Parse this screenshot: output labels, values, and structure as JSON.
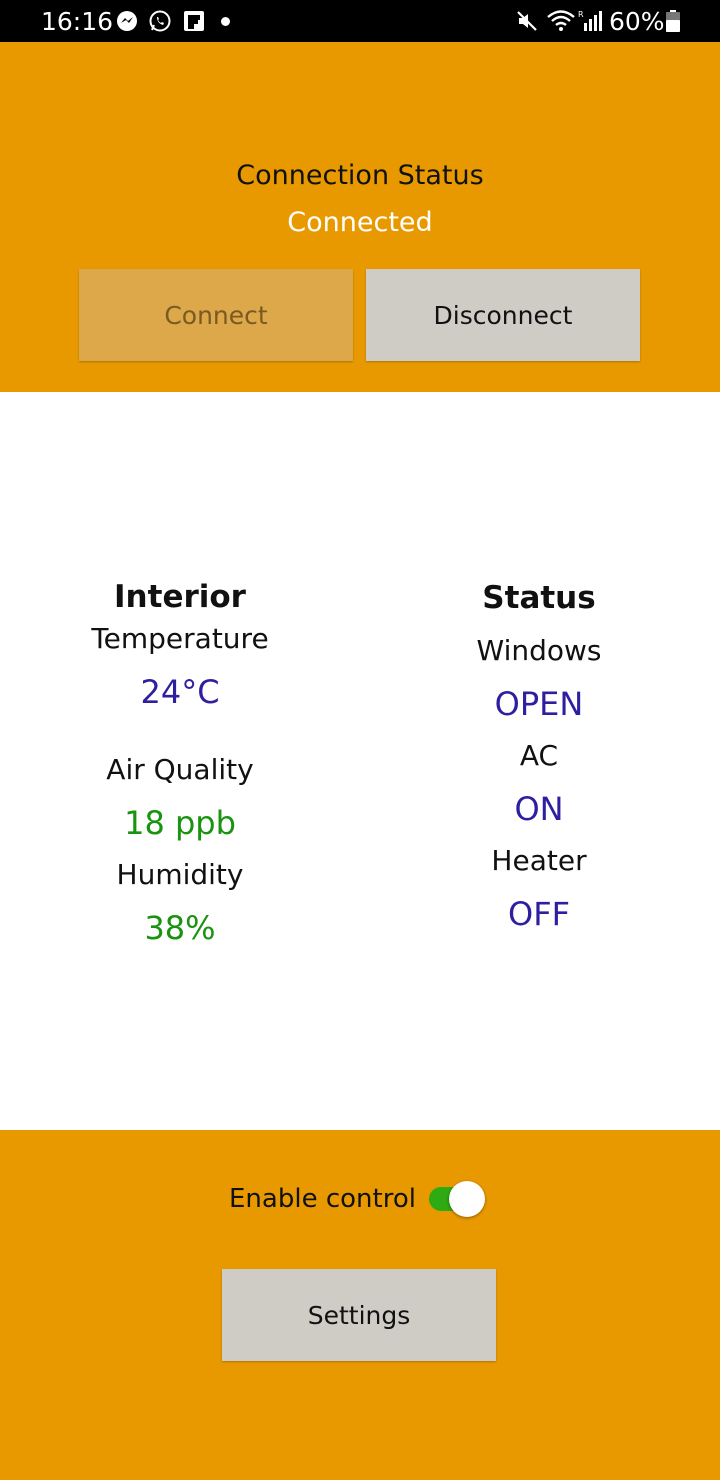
{
  "status_bar": {
    "time": "16:16",
    "icons": [
      "messenger-icon",
      "whatsapp-icon",
      "flipboard-icon",
      "dot-icon",
      "mute-icon",
      "wifi-icon",
      "signal-icon",
      "battery-icon"
    ],
    "battery_percent": "60%"
  },
  "connection": {
    "title": "Connection Status",
    "value": "Connected",
    "connect_label": "Connect",
    "disconnect_label": "Disconnect"
  },
  "interior": {
    "heading": "Interior",
    "temperature_label": "Temperature",
    "temperature_value": "24°C",
    "air_quality_label": "Air Quality",
    "air_quality_value": "18 ppb",
    "humidity_label": "Humidity",
    "humidity_value": "38%"
  },
  "status": {
    "heading": "Status",
    "windows_label": "Windows",
    "windows_value": "OPEN",
    "ac_label": "AC",
    "ac_value": "ON",
    "heater_label": "Heater",
    "heater_value": "OFF"
  },
  "controls": {
    "enable_label": "Enable control",
    "enable_on": true,
    "settings_label": "Settings"
  },
  "colors": {
    "accent": "#e99900",
    "blue_value": "#2d1fa0",
    "green_value": "#1a9410",
    "toggle_on": "#2eab12"
  }
}
